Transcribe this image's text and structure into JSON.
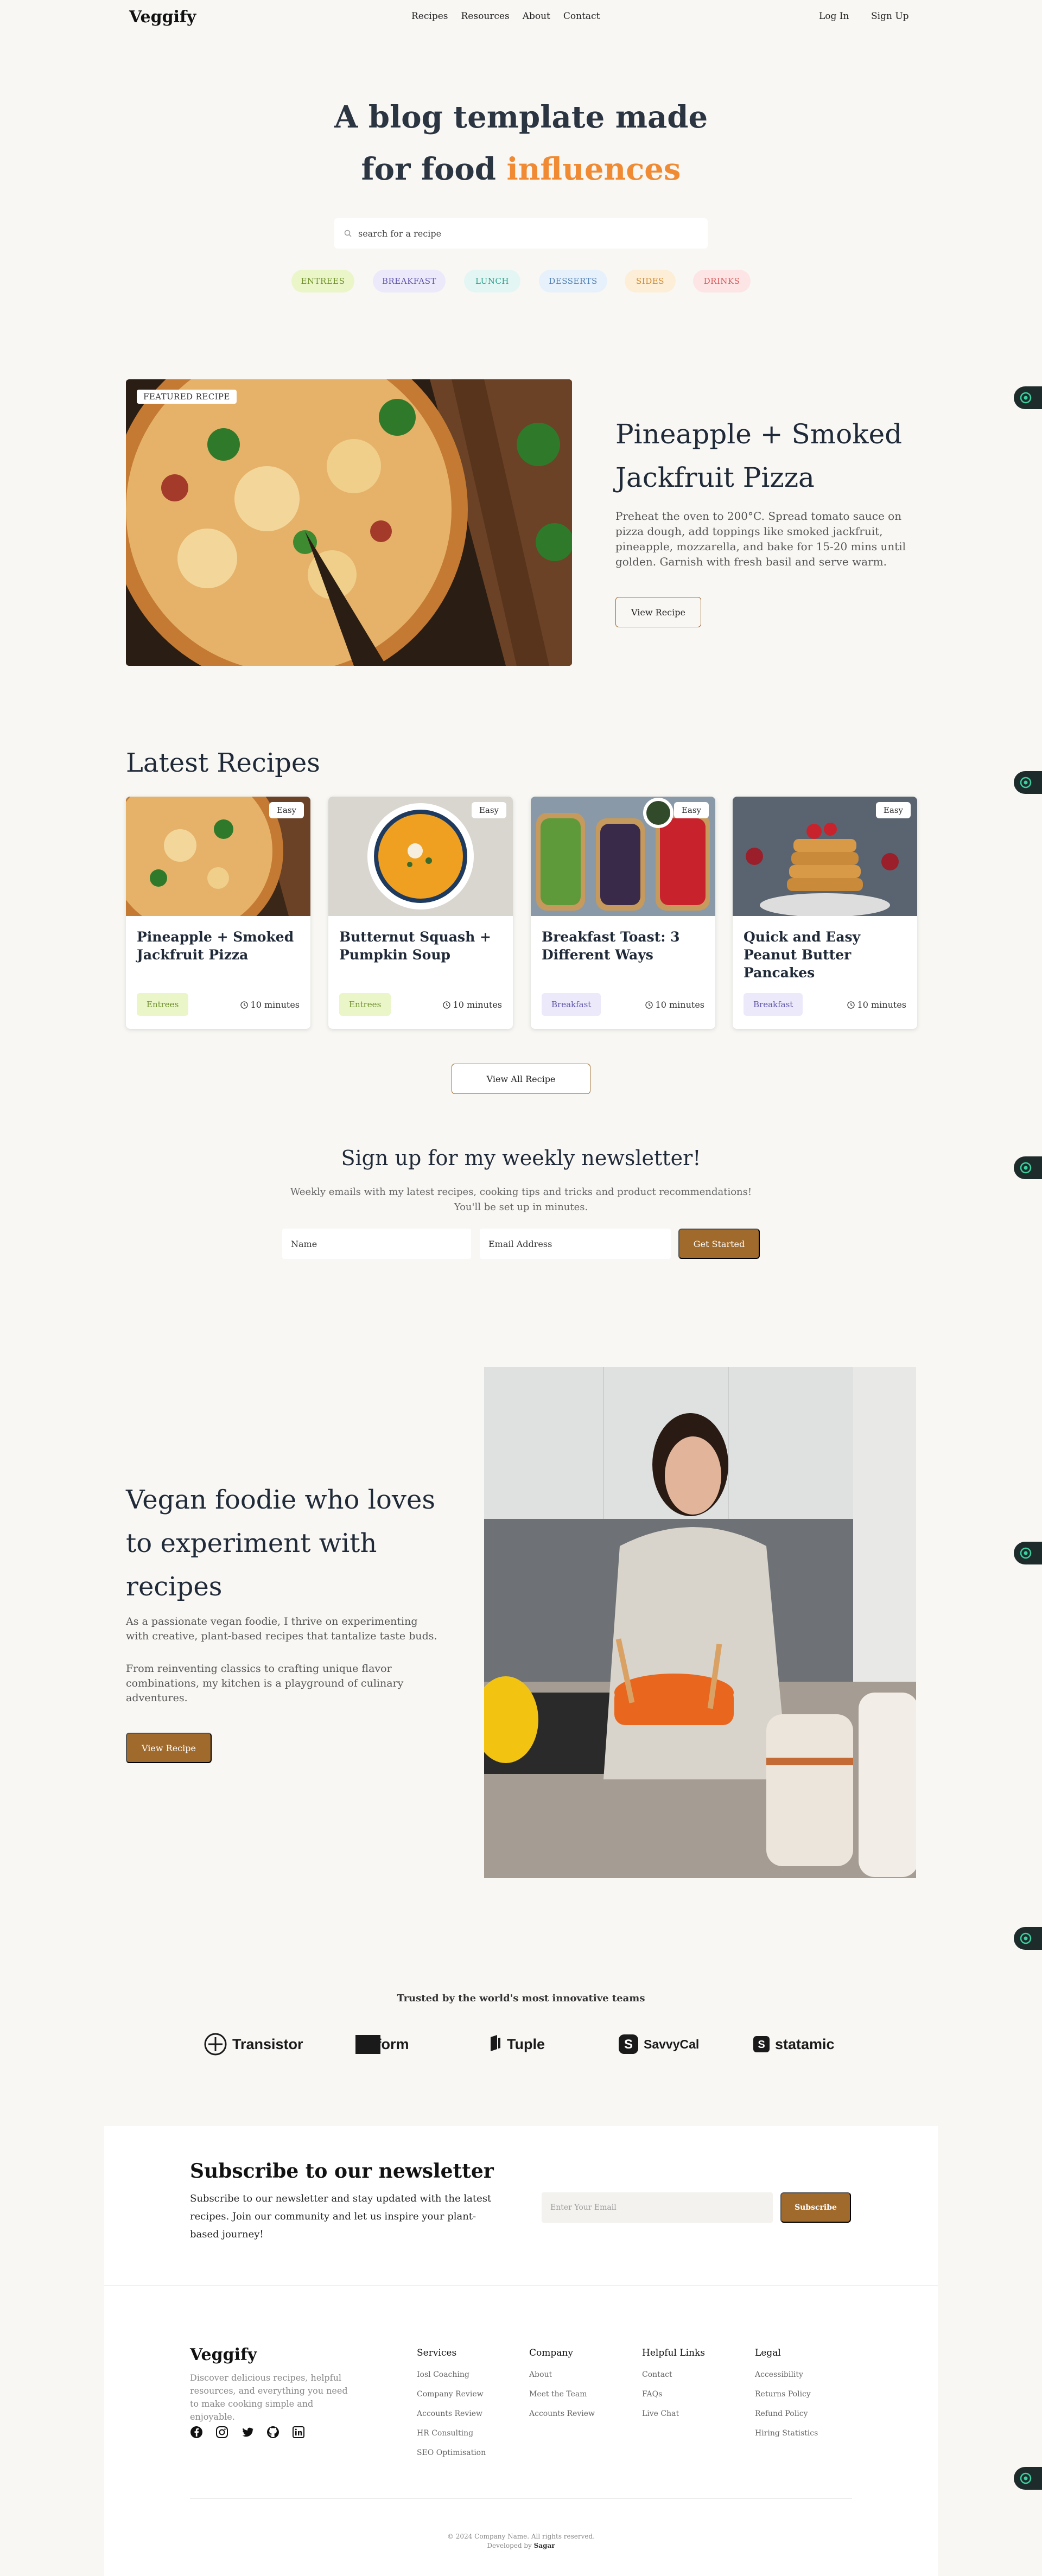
{
  "nav": {
    "brand": "Veggify",
    "links": [
      "Recipes",
      "Resources",
      "About",
      "Contact"
    ],
    "login": "Log In",
    "signup": "Sign Up"
  },
  "hero": {
    "title_line1": "A blog template made",
    "title_line2_plain": "for food ",
    "title_line2_accent": "influences",
    "search_placeholder": "search for a recipe",
    "chips": [
      {
        "label": "ENTREES",
        "bg": "#eaf6c8",
        "color": "#6f8f2c"
      },
      {
        "label": "BREAKFAST",
        "bg": "#ece9fb",
        "color": "#5e55a8"
      },
      {
        "label": "LUNCH",
        "bg": "#e3f6f3",
        "color": "#2f9f8c"
      },
      {
        "label": "DESSERTS",
        "bg": "#e7f1fb",
        "color": "#4f7fb2"
      },
      {
        "label": "SIDES",
        "bg": "#fdeed8",
        "color": "#d08a2e"
      },
      {
        "label": "DRINKS",
        "bg": "#fde5e5",
        "color": "#d65a5a"
      }
    ]
  },
  "featured": {
    "badge": "FEATURED RECIPE",
    "title": "Pineapple + Smoked Jackfruit Pizza",
    "description": "Preheat the oven to 200°C. Spread tomato sauce on pizza dough, add toppings like smoked jackfruit, pineapple, mozzarella, and bake for 15-20 mins until golden. Garnish with fresh basil and serve warm.",
    "button": "View Recipe"
  },
  "latest": {
    "title": "Latest Recipes",
    "cards": [
      {
        "title": "Pineapple + Smoked Jackfruit Pizza",
        "difficulty": "Easy",
        "tag": "Entrees",
        "time": "10 minutes",
        "tag_bg": "#eaf6c8",
        "tag_color": "#6f8f2c"
      },
      {
        "title": "Butternut Squash + Pumpkin Soup",
        "difficulty": "Easy",
        "tag": "Entrees",
        "time": "10 minutes",
        "tag_bg": "#eaf6c8",
        "tag_color": "#6f8f2c"
      },
      {
        "title": "Breakfast Toast: 3 Different Ways",
        "difficulty": "Easy",
        "tag": "Breakfast",
        "time": "10 minutes",
        "tag_bg": "#ece9fb",
        "tag_color": "#5e55a8"
      },
      {
        "title": "Quick and Easy Peanut Butter Pancakes",
        "difficulty": "Easy",
        "tag": "Breakfast",
        "time": "10 minutes",
        "tag_bg": "#ece9fb",
        "tag_color": "#5e55a8"
      }
    ],
    "view_all": "View All Recipe"
  },
  "newsletter": {
    "title": "Sign up for my weekly newsletter!",
    "desc_line1": "Weekly emails with my latest recipes, cooking tips and tricks and product recommendations!",
    "desc_line2": "You'll be set up in minutes.",
    "name_placeholder": "Name",
    "email_placeholder": "Email Address",
    "button": "Get Started"
  },
  "about": {
    "title": "Vegan foodie who loves to experiment with recipes",
    "p1": "As a passionate vegan foodie, I thrive on experimenting with creative, plant-based recipes that tantalize taste buds.",
    "p2": "From reinventing classics to crafting unique flavor combinations, my kitchen is a playground of culinary adventures.",
    "button": "View Recipe"
  },
  "trusted": {
    "title": "Trusted by the world's most innovative teams",
    "logos": [
      "Transistor",
      "Reform",
      "Tuple",
      "SavvyCal",
      "statamic"
    ]
  },
  "subscribe": {
    "title": "Subscribe to our newsletter",
    "desc": "Subscribe to our newsletter and stay updated with the latest recipes. Join our community and let us inspire your plant-based journey!",
    "placeholder": "Enter Your Email",
    "button": "Subscribe"
  },
  "footer": {
    "brand": "Veggify",
    "tagline": "Discover delicious recipes, helpful resources, and everything you need to make cooking simple and enjoyable.",
    "social_icons": [
      "facebook-icon",
      "instagram-icon",
      "twitter-icon",
      "github-icon",
      "linkedin-icon"
    ],
    "columns": [
      {
        "title": "Services",
        "links": [
          "Iosl Coaching",
          "Company Review",
          "Accounts Review",
          "HR Consulting",
          "SEO Optimisation"
        ]
      },
      {
        "title": "Company",
        "links": [
          "About",
          "Meet the Team",
          "Accounts Review"
        ]
      },
      {
        "title": "Helpful Links",
        "links": [
          "Contact",
          "FAQs",
          "Live Chat"
        ]
      },
      {
        "title": "Legal",
        "links": [
          "Accessibility",
          "Returns Policy",
          "Refund Policy",
          "Hiring Statistics"
        ]
      }
    ],
    "copyright": "© 2024 Company Name. All rights reserved.",
    "developed_prefix": "Developed by",
    "developer": "Sagar"
  }
}
